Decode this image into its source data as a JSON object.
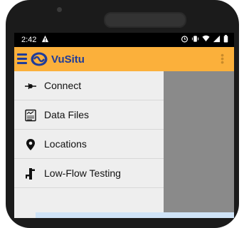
{
  "status_bar": {
    "time": "2:42",
    "warning_icon": "warning-icon",
    "alarm_icon": "alarm-icon",
    "vibrate_icon": "vibrate-icon",
    "wifi_icon": "wifi-icon",
    "signal_icon": "signal-icon",
    "battery_icon": "battery-icon"
  },
  "app_bar": {
    "title": "VuSitu",
    "menu_icon": "hamburger-menu-icon",
    "logo_icon": "vusitu-logo-icon",
    "overflow_icon": "more-vert-icon",
    "color": "#fbb03b",
    "title_color": "#1f3c99"
  },
  "drawer": {
    "items": [
      {
        "label": "Connect",
        "icon": "connect-icon"
      },
      {
        "label": "Data Files",
        "icon": "data-files-icon"
      },
      {
        "label": "Locations",
        "icon": "location-pin-icon"
      },
      {
        "label": "Low-Flow Testing",
        "icon": "low-flow-testing-icon"
      }
    ]
  }
}
